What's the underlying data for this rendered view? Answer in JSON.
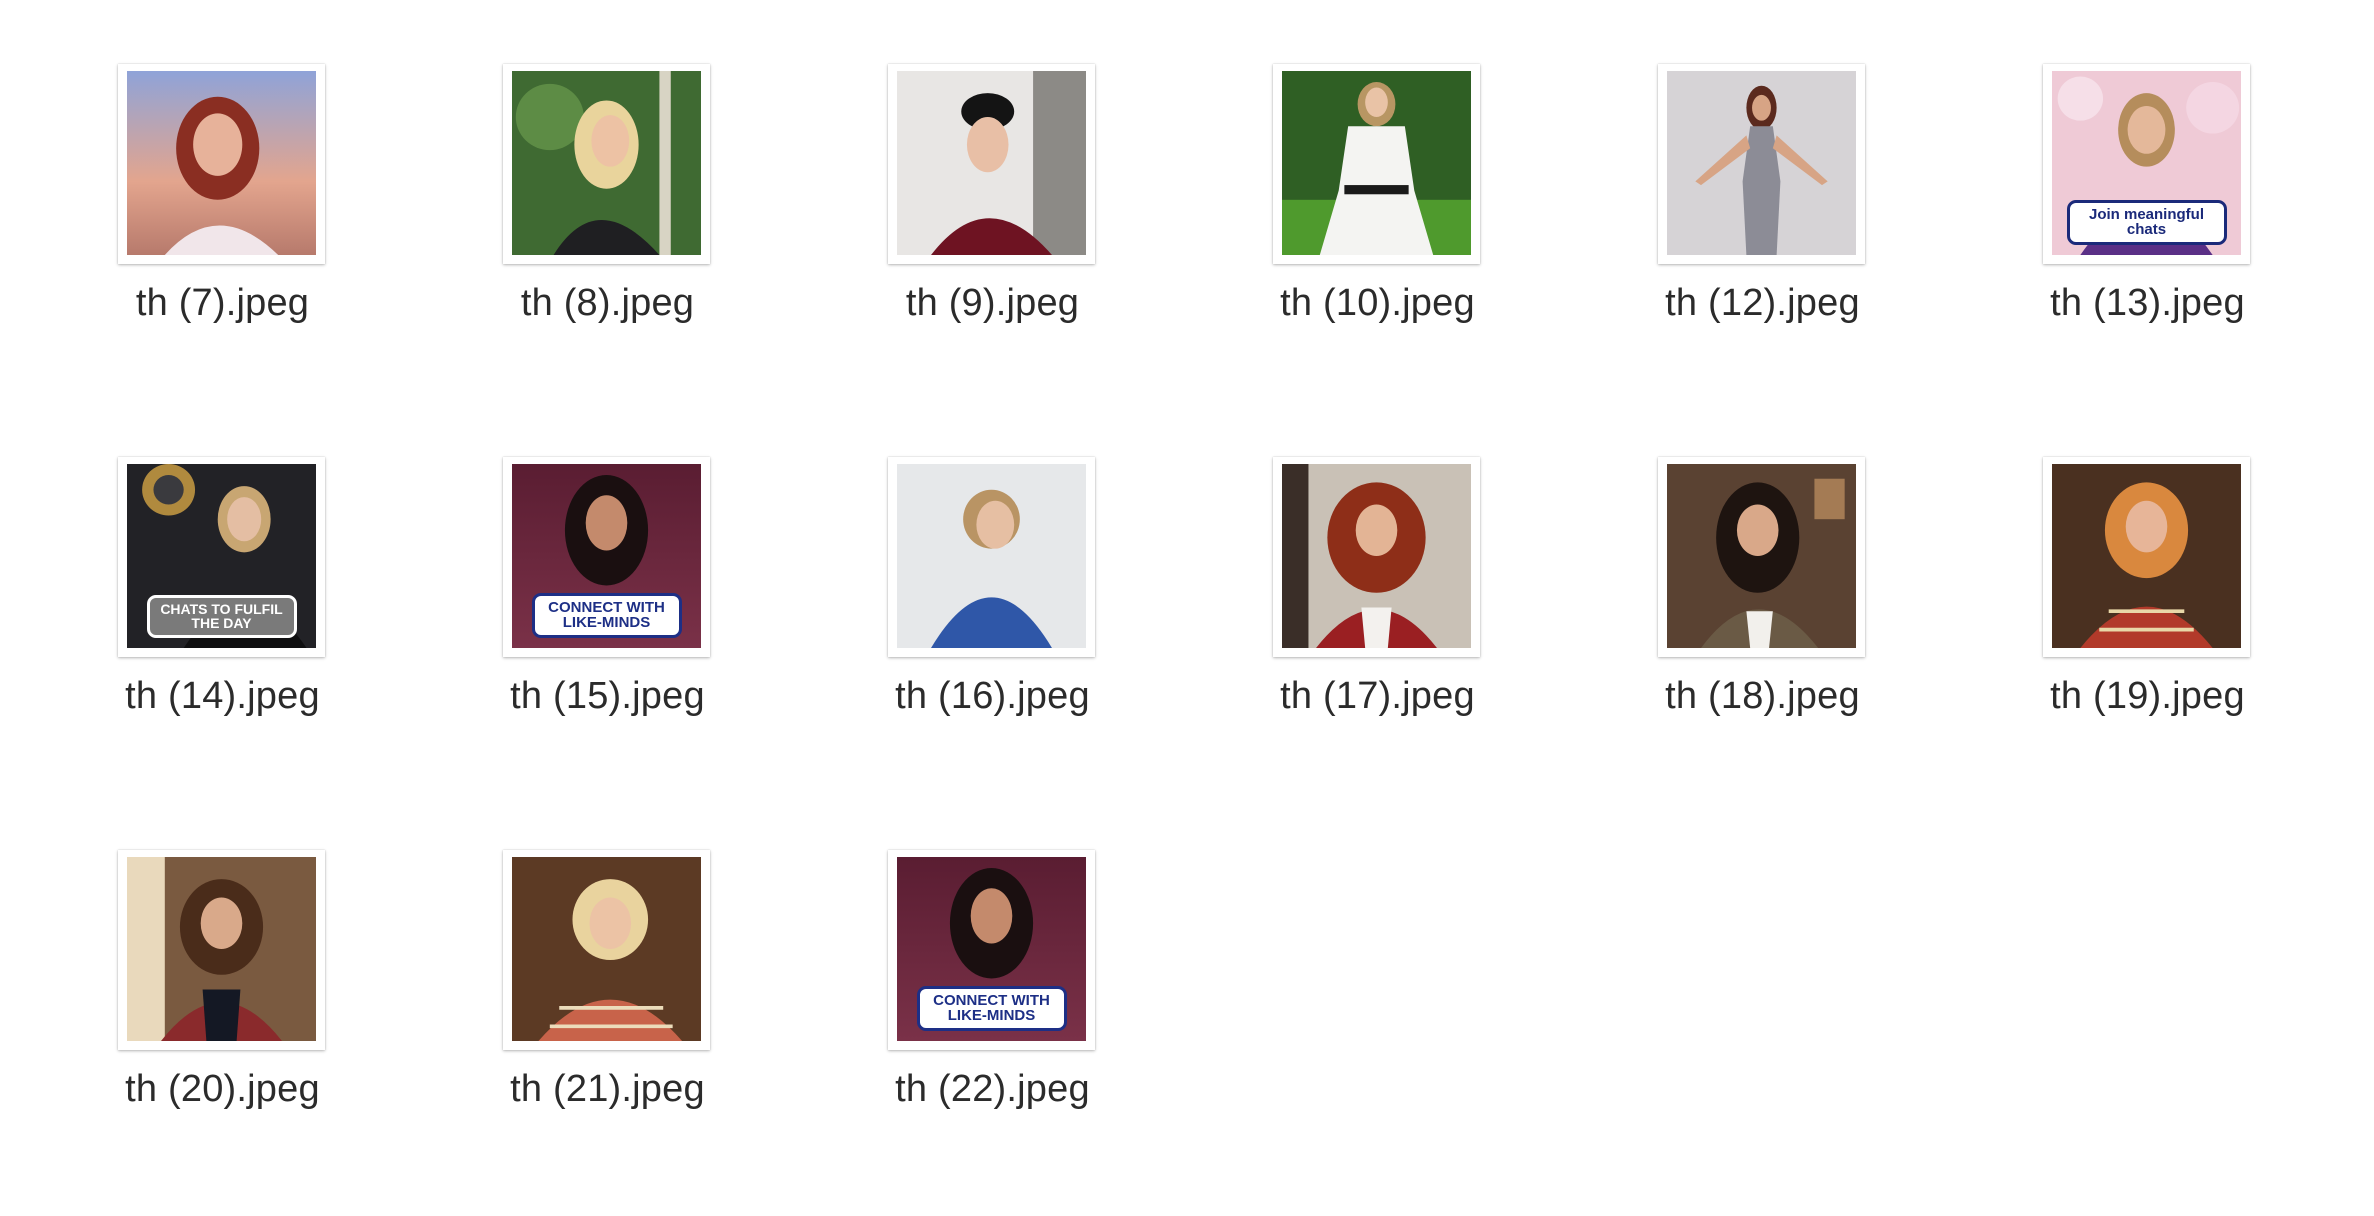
{
  "files": [
    {
      "name": "th (7).jpeg",
      "watermark": "",
      "badge": ""
    },
    {
      "name": "th (8).jpeg",
      "watermark": "",
      "badge": ""
    },
    {
      "name": "th (9).jpeg",
      "watermark": "",
      "badge": ""
    },
    {
      "name": "th (10).jpeg",
      "watermark": "",
      "badge": ""
    },
    {
      "name": "th (12).jpeg",
      "watermark": "",
      "badge": ""
    },
    {
      "name": "th (13).jpeg",
      "watermark": "",
      "badge": "Join meaningful chats"
    },
    {
      "name": "th (14).jpeg",
      "watermark": "",
      "badge": "CHATS TO FULFIL THE DAY"
    },
    {
      "name": "th (15).jpeg",
      "watermark": "",
      "badge": "CONNECT WITH LIKE-MINDS"
    },
    {
      "name": "th (16).jpeg",
      "watermark": "",
      "badge": ""
    },
    {
      "name": "th (17).jpeg",
      "watermark": "",
      "badge": ""
    },
    {
      "name": "th (18).jpeg",
      "watermark": "",
      "badge": ""
    },
    {
      "name": "th (19).jpeg",
      "watermark": "",
      "badge": ""
    },
    {
      "name": "th (20).jpeg",
      "watermark": "",
      "badge": ""
    },
    {
      "name": "th (21).jpeg",
      "watermark": "",
      "badge": ""
    },
    {
      "name": "th (22).jpeg",
      "watermark": "",
      "badge": "CONNECT WITH LIKE-MINDS"
    }
  ]
}
